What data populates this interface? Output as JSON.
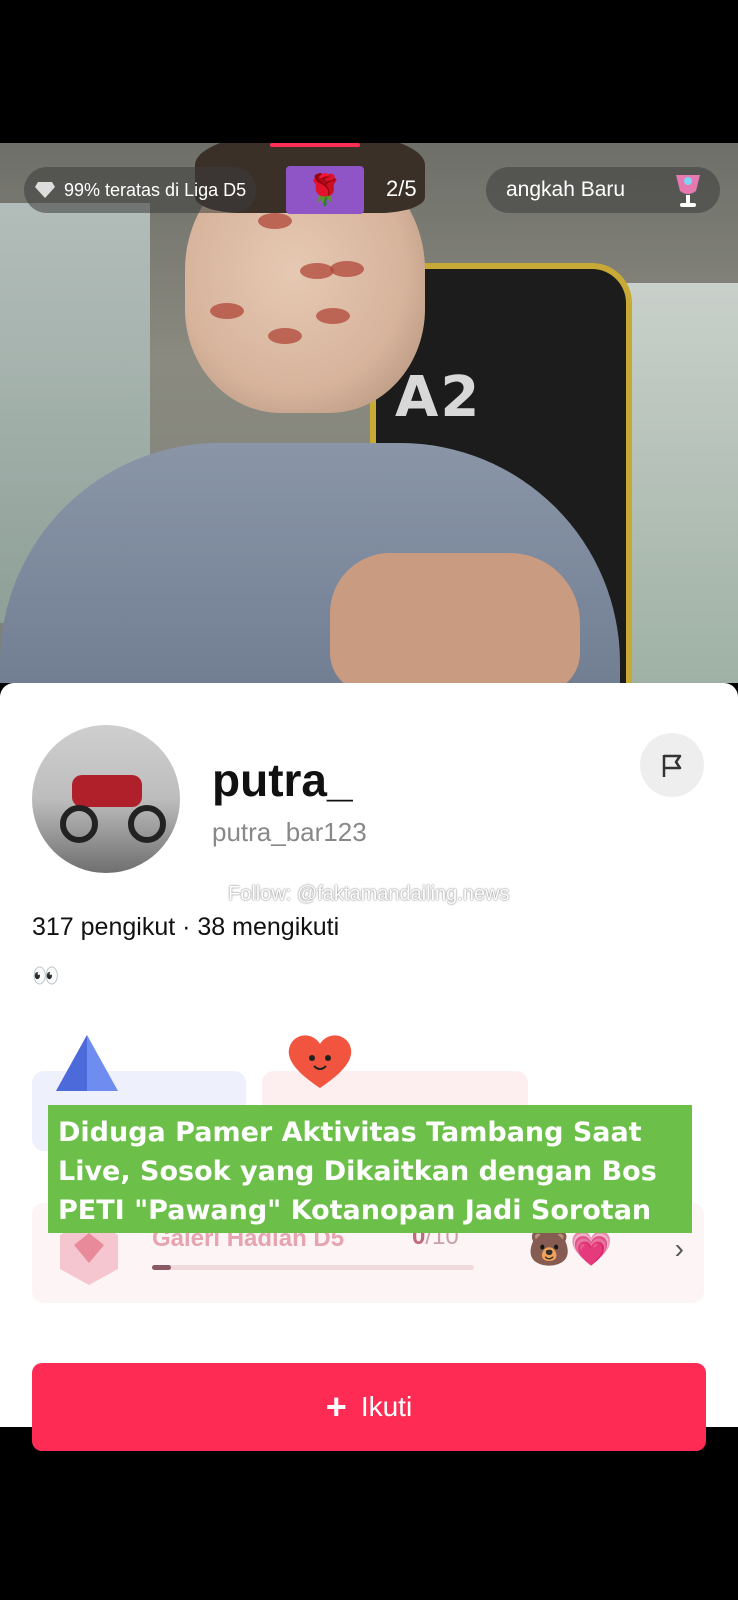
{
  "top_bar": {
    "rank_text": "99% teratas di Liga D5",
    "gift_count": "2/5",
    "right_text": "angkah Baru"
  },
  "profile": {
    "display_name": "putra_",
    "username": "putra_bar123",
    "watermark": "Follow: @faktamandailing.news",
    "followers": "317 pengikut",
    "following": "38 mengikuti",
    "stats_separator": " · ",
    "bio": "👀"
  },
  "gallery": {
    "title": "Galeri Hadiah D5",
    "count_current": "0",
    "count_total": "/10",
    "progress": 0.06
  },
  "follow_button": {
    "label": "Ikuti"
  },
  "news_banner": {
    "text": "Diduga Pamer Aktivitas Tambang Saat Live, Sosok yang Dikaitkan dengan Bos PETI \"Pawang\" Kotanopan Jadi Sorotan"
  },
  "colors": {
    "follow_button": "#fe2c55",
    "banner": "#6cc04a"
  },
  "icons": [
    "diamond-icon",
    "rose-icon",
    "trophy-cup-icon",
    "flag-icon",
    "triangle-gem-icon",
    "heart-icon",
    "gift-icon",
    "chevron-right-icon",
    "plus-icon"
  ]
}
